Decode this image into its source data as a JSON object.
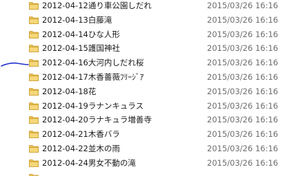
{
  "rows": [
    {
      "name": "2012-04-12通り車公園しだれ",
      "date": "2015/03/26 16:16"
    },
    {
      "name": "2012-04-13白藤滝",
      "date": "2015/03/26 16:16"
    },
    {
      "name": "2012-04-14ひな人形",
      "date": "2015/03/26 16:16"
    },
    {
      "name": "2012-04-15護国神社",
      "date": "2015/03/26 16:16"
    },
    {
      "name": "2012-04-16大河内しだれ桜",
      "date": "2015/03/26 16:16"
    },
    {
      "name": "2012-04-17木香薔薇ﾌﾘｰｼﾞｱ",
      "date": "2015/03/26 16:16"
    },
    {
      "name": "2012-04-18花",
      "date": "2015/03/26 16:16"
    },
    {
      "name": "2012-04-19ラナンキュラス",
      "date": "2015/03/26 16:16"
    },
    {
      "name": "2012-04-20ラナキュラ増善寺",
      "date": "2015/03/26 16:16"
    },
    {
      "name": "2012-04-21木香バラ",
      "date": "2015/03/26 16:16"
    },
    {
      "name": "2012-04-22並木の雨",
      "date": "2015/03/26 16:16"
    },
    {
      "name": "2012-04-24男女不動の滝",
      "date": "2015/03/26 16:16"
    },
    {
      "name": "",
      "date": ""
    }
  ],
  "colors": {
    "folder_body": "#e8bf52",
    "folder_front": "#f5d77a",
    "folder_edge": "#c89a2a",
    "annotation": "#1e2fcf"
  },
  "icons": {
    "row_icon": "folder-icon",
    "annotation": "hand-drawn-mark"
  }
}
